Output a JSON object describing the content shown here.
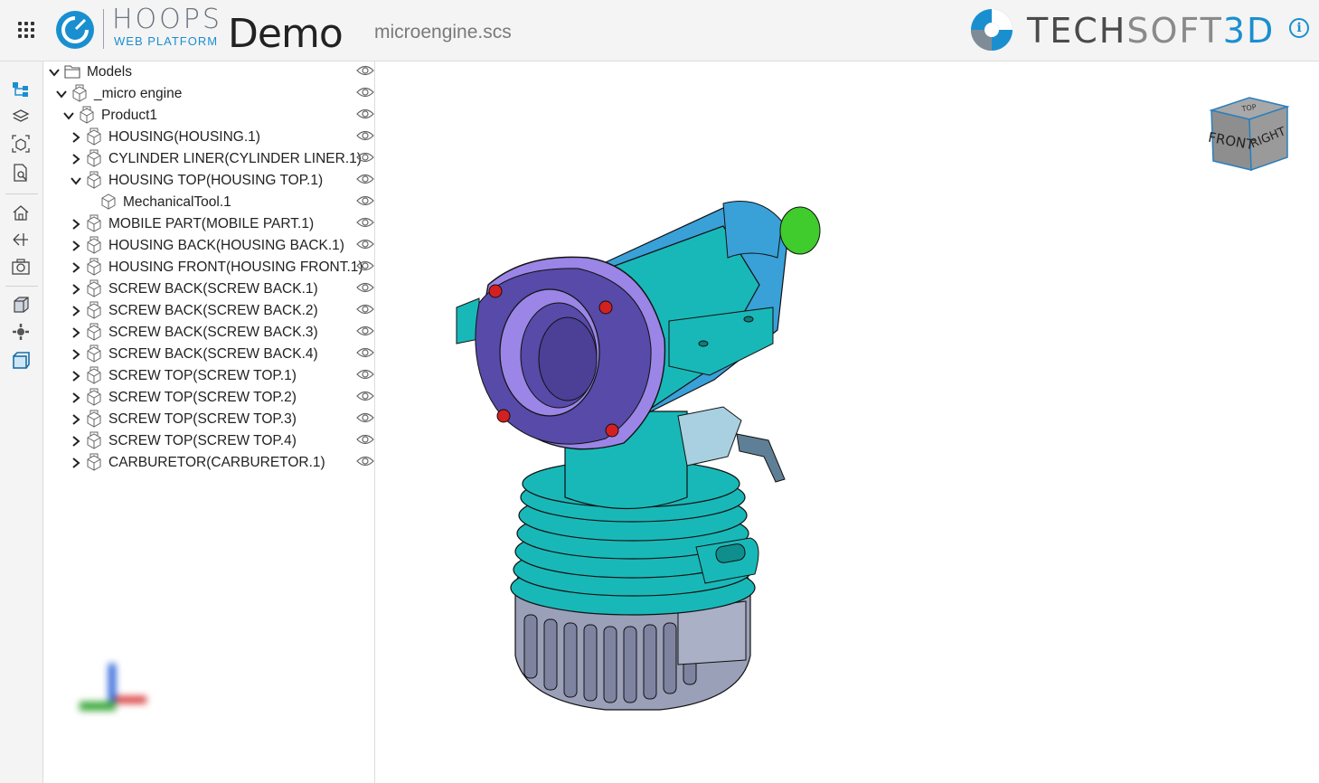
{
  "header": {
    "brand_name": "HOOPS",
    "brand_sub": "WEB PLATFORM",
    "title": "Demo",
    "filename": "microengine.scs",
    "company_parts": [
      "TECH",
      "SOFT",
      "3D"
    ],
    "info_label": "i",
    "accent_color": "#1a8fd0"
  },
  "toolbar": {
    "items": [
      {
        "name": "model-tree-icon",
        "active": true
      },
      {
        "name": "layers-icon"
      },
      {
        "name": "types-icon"
      },
      {
        "name": "properties-search-icon"
      },
      {
        "name": "home-icon"
      },
      {
        "name": "redline-icon"
      },
      {
        "name": "snapshot-icon"
      },
      {
        "name": "shaded-cube-icon"
      },
      {
        "name": "explode-icon"
      },
      {
        "name": "cutting-plane-icon"
      }
    ]
  },
  "tree": {
    "rows": [
      {
        "label": "Models",
        "depth": 0,
        "expanded": true,
        "icon": "folder"
      },
      {
        "label": "_micro engine",
        "depth": 1,
        "expanded": true,
        "icon": "assembly"
      },
      {
        "label": "Product1",
        "depth": 2,
        "expanded": true,
        "icon": "assembly"
      },
      {
        "label": "HOUSING(HOUSING.1)",
        "depth": 3,
        "expanded": false,
        "icon": "assembly"
      },
      {
        "label": "CYLINDER LINER(CYLINDER LINER.1)",
        "depth": 3,
        "expanded": false,
        "icon": "assembly"
      },
      {
        "label": "HOUSING TOP(HOUSING TOP.1)",
        "depth": 3,
        "expanded": true,
        "icon": "assembly"
      },
      {
        "label": "MechanicalTool.1",
        "depth": 4,
        "expanded": null,
        "icon": "part"
      },
      {
        "label": "MOBILE PART(MOBILE PART.1)",
        "depth": 3,
        "expanded": false,
        "icon": "assembly"
      },
      {
        "label": "HOUSING BACK(HOUSING BACK.1)",
        "depth": 3,
        "expanded": false,
        "icon": "assembly"
      },
      {
        "label": "HOUSING FRONT(HOUSING FRONT.1)",
        "depth": 3,
        "expanded": false,
        "icon": "assembly"
      },
      {
        "label": "SCREW BACK(SCREW BACK.1)",
        "depth": 3,
        "expanded": false,
        "icon": "assembly"
      },
      {
        "label": "SCREW BACK(SCREW BACK.2)",
        "depth": 3,
        "expanded": false,
        "icon": "assembly"
      },
      {
        "label": "SCREW BACK(SCREW BACK.3)",
        "depth": 3,
        "expanded": false,
        "icon": "assembly"
      },
      {
        "label": "SCREW BACK(SCREW BACK.4)",
        "depth": 3,
        "expanded": false,
        "icon": "assembly"
      },
      {
        "label": "SCREW TOP(SCREW TOP.1)",
        "depth": 3,
        "expanded": false,
        "icon": "assembly"
      },
      {
        "label": "SCREW TOP(SCREW TOP.2)",
        "depth": 3,
        "expanded": false,
        "icon": "assembly"
      },
      {
        "label": "SCREW TOP(SCREW TOP.3)",
        "depth": 3,
        "expanded": false,
        "icon": "assembly"
      },
      {
        "label": "SCREW TOP(SCREW TOP.4)",
        "depth": 3,
        "expanded": false,
        "icon": "assembly"
      },
      {
        "label": "CARBURETOR(CARBURETOR.1)",
        "depth": 3,
        "expanded": false,
        "icon": "assembly"
      }
    ]
  },
  "navcube": {
    "top": "TOP",
    "front": "FRONT",
    "right": "RIGHT"
  },
  "colors": {
    "teal": "#19b8b8",
    "blue": "#3aa0d8",
    "purple": "#9b85e6",
    "green": "#3fcc2c",
    "grey": "#9aa0b8",
    "screw": "#d42020"
  }
}
